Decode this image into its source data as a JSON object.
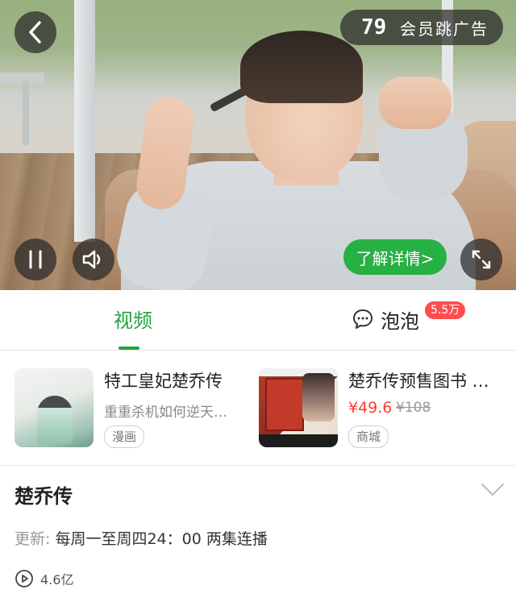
{
  "player": {
    "ad_countdown": "79",
    "ad_skip_label": "会员跳广告",
    "detail_button": "了解详情>"
  },
  "tabs": {
    "video": "视频",
    "bubble": "泡泡",
    "bubble_badge": "5.5万"
  },
  "cards": [
    {
      "title": "特工皇妃楚乔传",
      "subtitle": "重重杀机如何逆天…",
      "tag": "漫画"
    },
    {
      "title": "楚乔传预售图书 …",
      "price": "¥49.6",
      "old_price": "¥108",
      "tag": "商城"
    }
  ],
  "show": {
    "title": "楚乔传",
    "update_label": "更新:",
    "update_schedule": "每周一至周四24：00 两集连播",
    "play_count": "4.6亿"
  },
  "colors": {
    "accent_green": "#1fa33d",
    "badge_red": "#ff4d4f",
    "price_red": "#ff3b30"
  },
  "icons": [
    "back-icon",
    "pause-icon",
    "volume-icon",
    "fullscreen-icon",
    "chat-bubble-icon",
    "chevron-down-icon",
    "play-circle-icon"
  ]
}
